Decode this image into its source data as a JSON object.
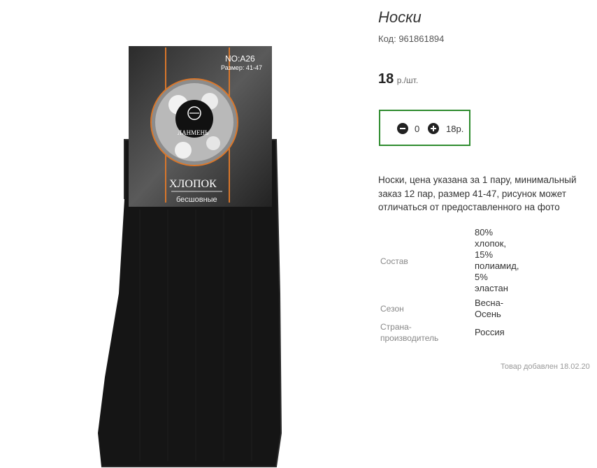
{
  "product": {
    "title": "Носки",
    "code": "Код: 961861894",
    "price_value": "18",
    "price_unit": "р./шт.",
    "description": "Носки, цена указана за 1 пару, минимальный заказ 12 пар, размер 41-47, рисунок может отличаться от предоставленного на фото",
    "added": "Товар добавлен 18.02.20"
  },
  "quantity": {
    "value": "0",
    "sum": "18р."
  },
  "properties": [
    {
      "key_lines": [
        "Состав"
      ],
      "value_lines": [
        "80%",
        "хлопок,",
        "15%",
        "полиамид,",
        "5%",
        "эластан"
      ]
    },
    {
      "key_lines": [
        "Сезон"
      ],
      "value_lines": [
        "Весна-",
        "Осень"
      ]
    },
    {
      "key_lines": [
        "Страна-",
        "производитель"
      ],
      "value_lines": [
        "Россия"
      ]
    }
  ],
  "label": {
    "model": "NO:A26",
    "size": "Размер: 41-47",
    "brand": "ЛАНМЕНЬ",
    "material": "ХЛОПОК",
    "feature": "бесшовные"
  },
  "colors": {
    "accent_border": "#2e8b2e",
    "sock": "#151515",
    "label_orange": "#d9772b"
  }
}
